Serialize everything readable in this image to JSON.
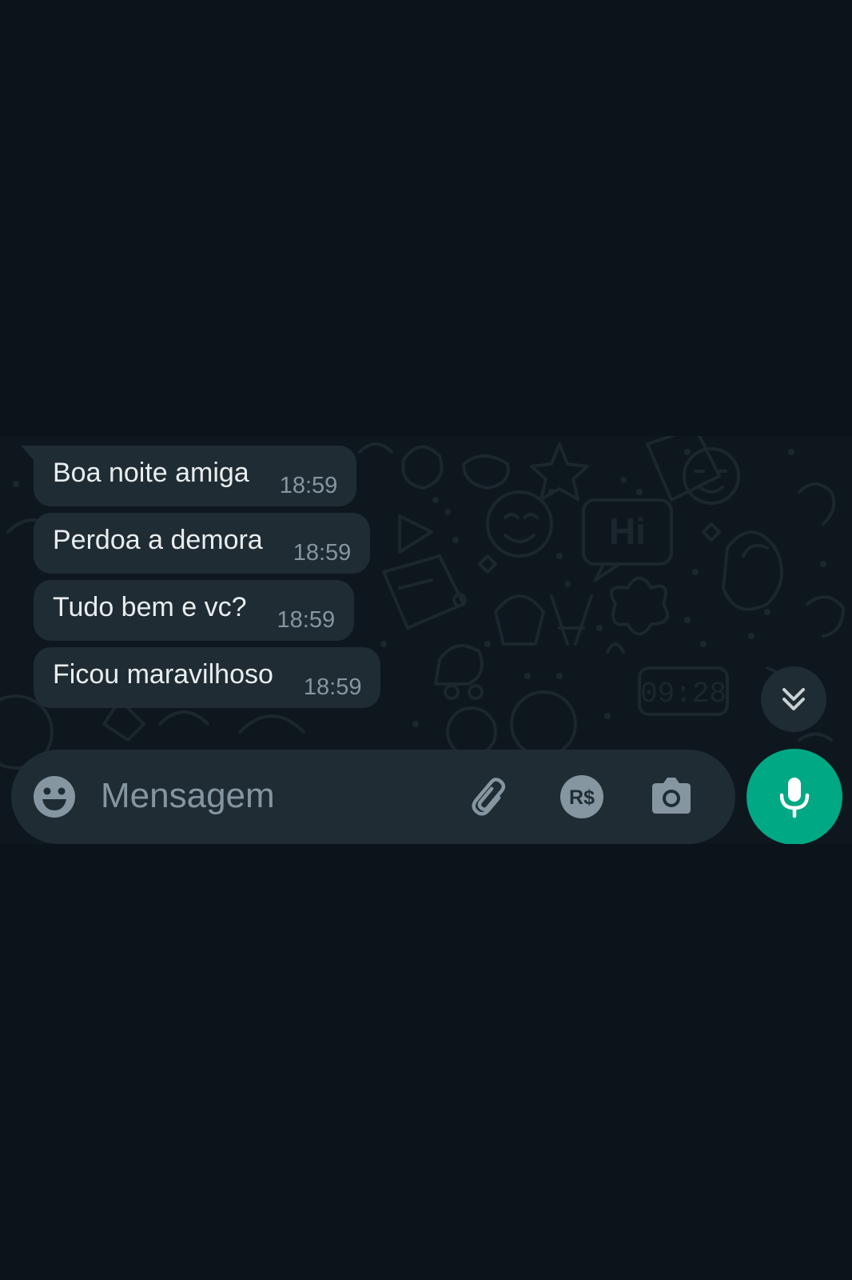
{
  "messages": [
    {
      "text": "Boa noite amiga",
      "time": "18:59"
    },
    {
      "text": "Perdoa a demora",
      "time": "18:59"
    },
    {
      "text": "Tudo bem e vc?",
      "time": "18:59"
    },
    {
      "text": "Ficou maravilhoso",
      "time": "18:59"
    }
  ],
  "wallpaper": {
    "hi_text": "Hi",
    "clock_text": "09:28"
  },
  "composer": {
    "placeholder": "Mensagem",
    "payment_label": "R$"
  },
  "icons": {
    "emoji": "emoji-icon",
    "attach": "paperclip-icon",
    "payment": "payment-icon",
    "camera": "camera-icon",
    "mic": "mic-icon",
    "scroll": "double-chevron-down-icon"
  },
  "colors": {
    "background": "#0b141a",
    "bubble": "#1f2c33",
    "text": "#e9edef",
    "muted": "#8696a0",
    "accent": "#00a884"
  }
}
